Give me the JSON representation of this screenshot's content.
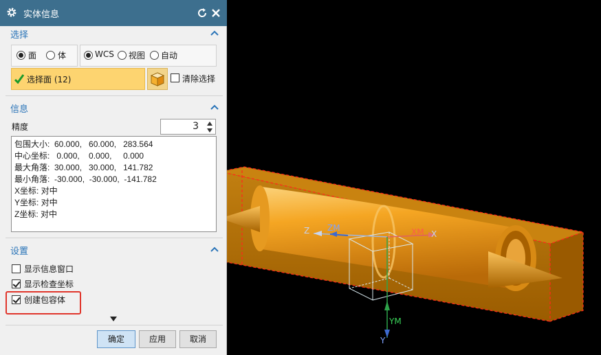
{
  "dialog": {
    "title": "实体信息",
    "sections": {
      "select": {
        "title": "选择"
      },
      "info": {
        "title": "信息"
      },
      "settings": {
        "title": "设置"
      }
    },
    "select_type": {
      "face_label": "面",
      "body_label": "体",
      "selected": "面"
    },
    "coordinate_mode": {
      "wcs_label": "WCS",
      "view_label": "视图",
      "auto_label": "自动",
      "selected": "WCS"
    },
    "select_face_button": "选择面 (12)",
    "clear_selection_label": "清除选择",
    "clear_selection_checked": false,
    "precision_label": "精度",
    "precision_value": "3",
    "info_lines": [
      "包围大小:  60.000,   60.000,   283.564",
      "中心坐标:   0.000,    0.000,     0.000",
      "最大角落:  30.000,   30.000,   141.782",
      "最小角落:  -30.000,  -30.000,  -141.782",
      "X坐标: 对中",
      "Y坐标: 对中",
      "Z坐标: 对中"
    ],
    "settings": {
      "show_info_window": {
        "label": "显示信息窗口",
        "checked": false
      },
      "show_check_coords": {
        "label": "显示检查坐标",
        "checked": true
      },
      "create_bounding_body": {
        "label": "创建包容体",
        "checked": true
      }
    },
    "buttons": {
      "ok": "确定",
      "apply": "应用",
      "cancel": "取消"
    }
  },
  "viewport": {
    "axis_labels": {
      "z": "Z",
      "zm": "ZM",
      "xm": "XM",
      "x": "X",
      "ym": "YM",
      "y": "Y"
    }
  },
  "colors": {
    "title_bar": "#3d6f8e",
    "section_title": "#2a74b8",
    "highlight_button": "#fdd470",
    "bounding_box": "#c97d00",
    "cylinder": "#f5a623",
    "box_edge_dashes": "#ff2a1a",
    "red_highlight": "#e0352b",
    "viewport_bg": "#000000"
  }
}
